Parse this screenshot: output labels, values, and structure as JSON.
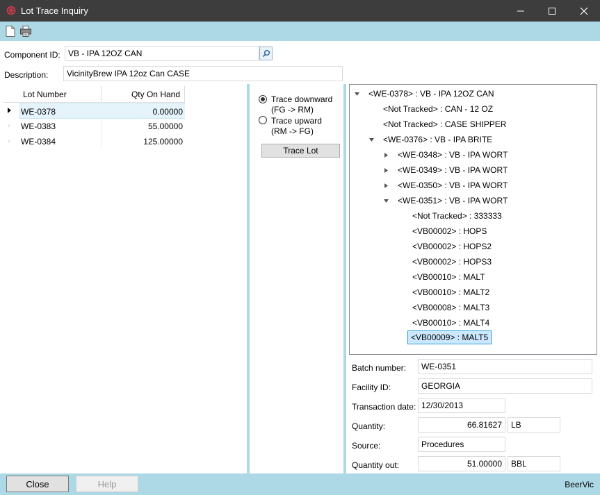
{
  "window": {
    "title": "Lot Trace Inquiry"
  },
  "toolbar": {
    "new_icon": "new-document-icon",
    "print_icon": "printer-icon"
  },
  "header": {
    "component_label": "Component ID:",
    "component_value": "VB - IPA 12OZ CAN",
    "description_label": "Description:",
    "description_value": "VicinityBrew IPA 12oz Can CASE"
  },
  "grid": {
    "columns": [
      "Lot Number",
      "Qty On Hand"
    ],
    "rows": [
      {
        "lot": "WE-0378",
        "qty": "0.00000"
      },
      {
        "lot": "WE-0383",
        "qty": "55.00000"
      },
      {
        "lot": "WE-0384",
        "qty": "125.00000"
      }
    ]
  },
  "trace": {
    "downward_line1": "Trace downward",
    "downward_line2": "(FG -> RM)",
    "upward_line1": "Trace upward",
    "upward_line2": "(RM -> FG)",
    "button": "Trace Lot"
  },
  "tree": [
    "<WE-0378> : VB - IPA 12OZ CAN",
    "<Not Tracked> : CAN - 12 OZ",
    "<Not Tracked> : CASE SHIPPER",
    "<WE-0376> : VB - IPA BRITE",
    "<WE-0348> : VB - IPA WORT",
    "<WE-0349> : VB - IPA WORT",
    "<WE-0350> : VB - IPA WORT",
    "<WE-0351> : VB - IPA WORT",
    "<Not Tracked> : 333333",
    "<VB00002> : HOPS",
    "<VB00002> : HOPS2",
    "<VB00002> : HOPS3",
    "<VB00010> : MALT",
    "<VB00010> : MALT2",
    "<VB00008> : MALT3",
    "<VB00010> : MALT4",
    "<VB00009> : MALT5"
  ],
  "details": {
    "batch_label": "Batch number:",
    "batch_value": "WE-0351",
    "facility_label": "Facility ID:",
    "facility_value": "GEORGIA",
    "date_label": "Transaction date:",
    "date_value": "12/30/2013",
    "qty_label": "Quantity:",
    "qty_value": "66.81627",
    "qty_unit": "LB",
    "source_label": "Source:",
    "source_value": "Procedures",
    "qtyout_label": "Quantity out:",
    "qtyout_value": "51.00000",
    "qtyout_unit": "BBL"
  },
  "footer": {
    "close": "Close",
    "help": "Help",
    "brand": "BeerVic"
  }
}
